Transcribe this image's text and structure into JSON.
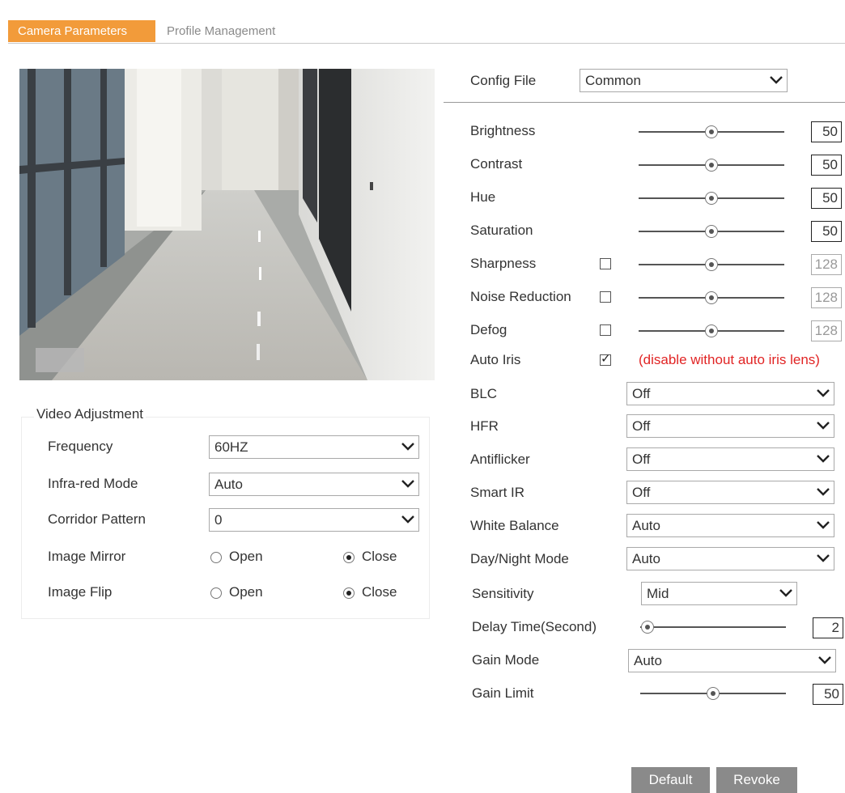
{
  "tabs": {
    "camera_parameters": "Camera Parameters",
    "profile_management": "Profile Management"
  },
  "config": {
    "label": "Config File",
    "value": "Common"
  },
  "image_params": {
    "brightness": {
      "label": "Brightness",
      "value": "50",
      "level": 0.5
    },
    "contrast": {
      "label": "Contrast",
      "value": "50",
      "level": 0.5
    },
    "hue": {
      "label": "Hue",
      "value": "50",
      "level": 0.5
    },
    "saturation": {
      "label": "Saturation",
      "value": "50",
      "level": 0.5
    },
    "sharpness": {
      "label": "Sharpness",
      "value": "128",
      "level": 0.5,
      "checked": false
    },
    "noise_reduction": {
      "label": "Noise Reduction",
      "value": "128",
      "level": 0.5,
      "checked": false
    },
    "defog": {
      "label": "Defog",
      "value": "128",
      "level": 0.5,
      "checked": false
    },
    "auto_iris": {
      "label": "Auto Iris",
      "checked": true,
      "warning": "(disable without auto iris lens)"
    }
  },
  "selects": {
    "blc": {
      "label": "BLC",
      "value": "Off"
    },
    "hfr": {
      "label": "HFR",
      "value": "Off"
    },
    "antiflicker": {
      "label": "Antiflicker",
      "value": "Off"
    },
    "smart_ir": {
      "label": "Smart IR",
      "value": "Off"
    },
    "white_balance": {
      "label": "White Balance",
      "value": "Auto"
    },
    "day_night_mode": {
      "label": "Day/Night Mode",
      "value": "Auto"
    },
    "sensitivity": {
      "label": "Sensitivity",
      "value": "Mid"
    }
  },
  "delay_time": {
    "label": "Delay Time(Second)",
    "value": "2",
    "level": 0.05
  },
  "gain_mode": {
    "label": "Gain Mode",
    "value": "Auto"
  },
  "gain_limit": {
    "label": "Gain Limit",
    "value": "50",
    "level": 0.5
  },
  "video_adjustment": {
    "title": "Video Adjustment",
    "frequency": {
      "label": "Frequency",
      "value": "60HZ"
    },
    "infrared_mode": {
      "label": "Infra-red Mode",
      "value": "Auto"
    },
    "corridor_pattern": {
      "label": "Corridor Pattern",
      "value": "0"
    },
    "image_mirror": {
      "label": "Image Mirror",
      "open": "Open",
      "close": "Close",
      "selected": "Close"
    },
    "image_flip": {
      "label": "Image Flip",
      "open": "Open",
      "close": "Close",
      "selected": "Close"
    }
  },
  "buttons": {
    "default": "Default",
    "revoke": "Revoke"
  },
  "icons": {
    "dropdown": "chevron-down-icon",
    "slider": "slider-knob-icon"
  }
}
